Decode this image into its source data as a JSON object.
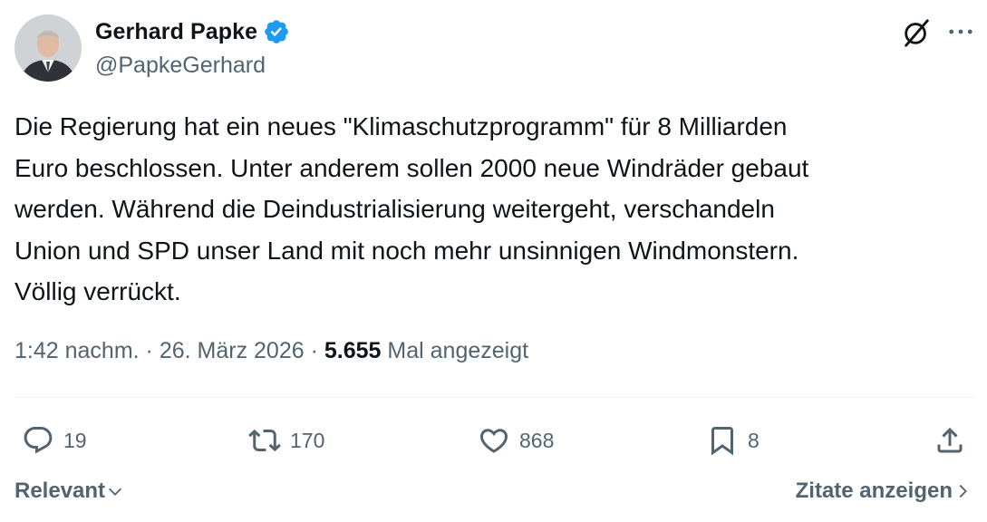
{
  "author": {
    "display_name": "Gerhard Papke",
    "handle": "@PapkeGerhard",
    "verified": true,
    "avatar_icon": "avatar-photo"
  },
  "tweet": {
    "text": "Die Regierung hat ein neues \"Klimaschutzprogramm\" für 8 Milliarden\nEuro beschlossen. Unter anderem sollen 2000 neue Windräder gebaut\nwerden. Während die Deindustrialisierung weitergeht, verschandeln\nUnion und SPD unser Land mit noch mehr unsinnigen Windmonstern.\nVöllig verrückt."
  },
  "meta": {
    "time": "1:42 nachm.",
    "separator": "·",
    "date": "26. März 2026",
    "views_count": "5.655",
    "views_label": "Mal angezeigt"
  },
  "actions": {
    "replies": "19",
    "reposts": "170",
    "likes": "868",
    "bookmarks": "8"
  },
  "footer": {
    "sort_label": "Relevant",
    "quotes_label": "Zitate anzeigen"
  },
  "colors": {
    "verified_blue": "#1d9bf0",
    "secondary_text": "#536471",
    "primary_text": "#0f1419"
  }
}
